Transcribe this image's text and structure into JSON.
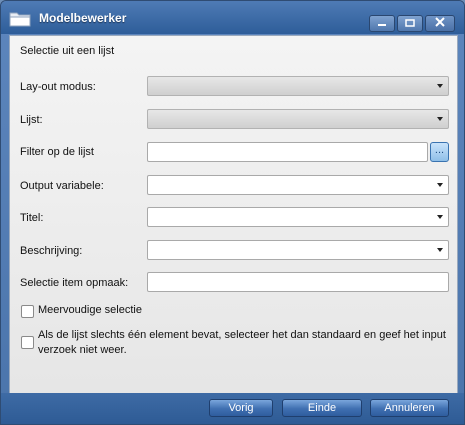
{
  "window": {
    "title": "Modelbewerker"
  },
  "form": {
    "section_title": "Selectie uit een lijst",
    "layout_mode_label": "Lay-out modus:",
    "list_label": "Lijst:",
    "filter_label": "Filter op de lijst",
    "filter_button": "...",
    "output_label": "Output variabele:",
    "title_label": "Titel:",
    "description_label": "Beschrijving:",
    "item_format_label": "Selectie item opmaak:",
    "multi_select_label": "Meervoudige selectie",
    "single_element_label": "Als de lijst slechts één element bevat, selecteer het dan standaard en geef het input verzoek niet weer."
  },
  "buttons": {
    "prev": "Vorig",
    "finish": "Einde",
    "cancel": "Annuleren"
  },
  "icons": {
    "app": "folder-icon",
    "minimize": "minimize-icon",
    "maximize": "maximize-icon",
    "close": "close-icon",
    "dropdown": "chevron-down-icon"
  },
  "colors": {
    "titlebar": "#2e5d99",
    "content_bg": "#eeeeee",
    "button": "#3f6fb1"
  }
}
